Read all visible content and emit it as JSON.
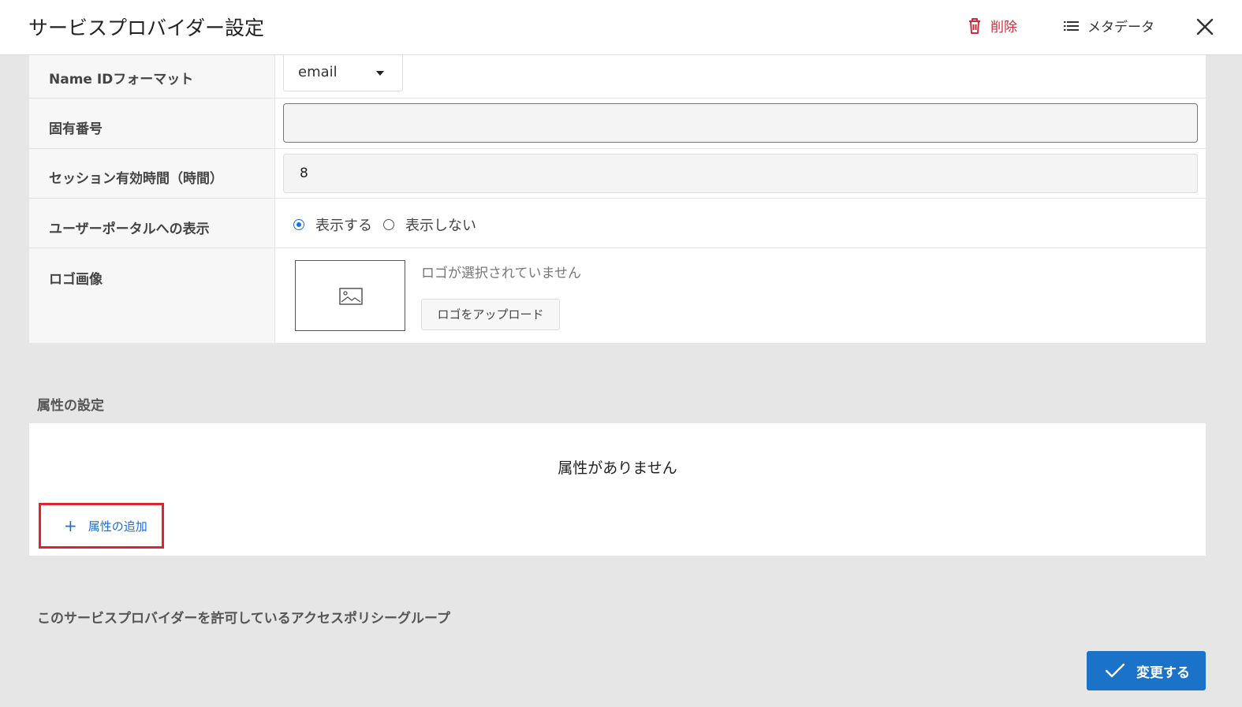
{
  "header": {
    "title": "サービスプロバイダー設定",
    "delete_label": "削除",
    "metadata_label": "メタデータ",
    "delete_color": "#c62f3c"
  },
  "form": {
    "name_id_format": {
      "label": "Name IDフォーマット",
      "value": "email"
    },
    "unique_number": {
      "label": "固有番号",
      "value": ""
    },
    "session_duration": {
      "label": "セッション有効時間（時間）",
      "value": "8"
    },
    "portal_display": {
      "label": "ユーザーポータルへの表示",
      "options": [
        "表示する",
        "表示しない"
      ],
      "selected": "表示する"
    },
    "logo": {
      "label": "ロゴ画像",
      "empty_text": "ロゴが選択されていません",
      "upload_label": "ロゴをアップロード"
    }
  },
  "attributes": {
    "section_title": "属性の設定",
    "empty_text": "属性がありません",
    "add_label": "属性の追加"
  },
  "policy_groups": {
    "section_title": "このサービスプロバイダーを許可しているアクセスポリシーグループ"
  },
  "footer": {
    "submit_label": "変更する",
    "accent_color": "#1a73c8"
  }
}
